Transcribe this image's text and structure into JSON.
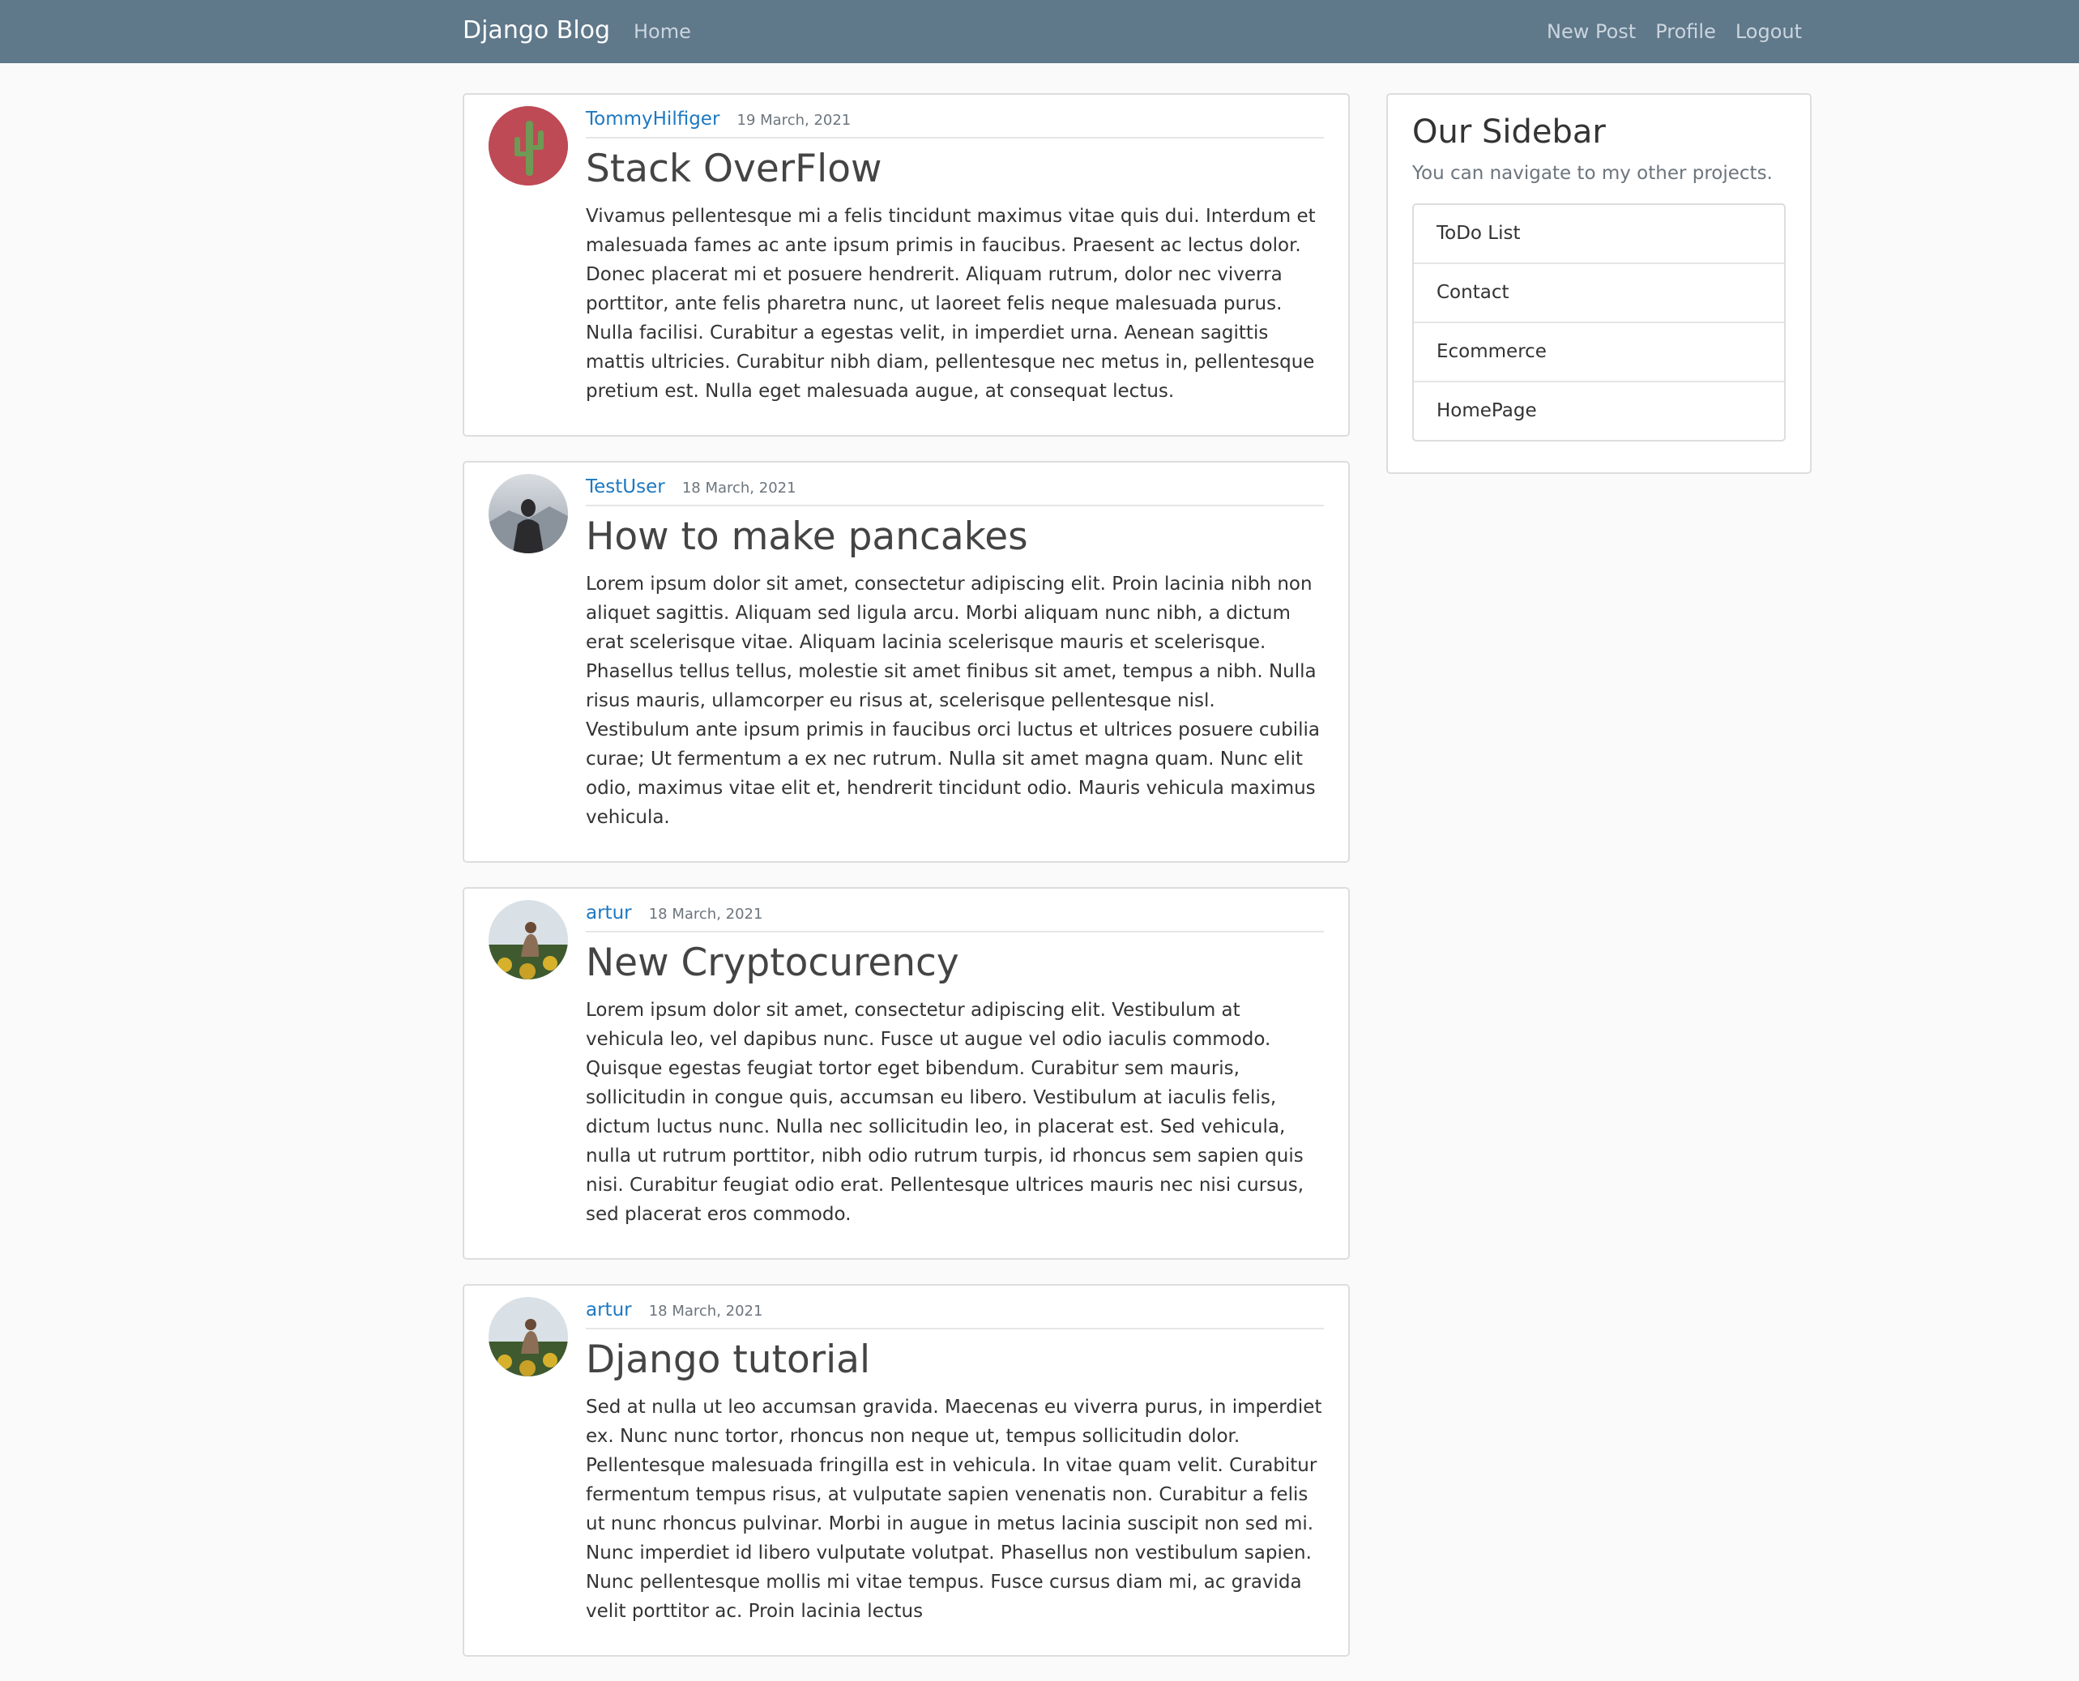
{
  "navbar": {
    "brand": "Django Blog",
    "home": "Home",
    "new_post": "New Post",
    "profile": "Profile",
    "logout": "Logout"
  },
  "posts": [
    {
      "author": "TommyHilfiger",
      "date": "19 March, 2021",
      "title": "Stack OverFlow",
      "content": "Vivamus pellentesque mi a felis tincidunt maximus vitae quis dui. Interdum et malesuada fames ac ante ipsum primis in faucibus. Praesent ac lectus dolor. Donec placerat mi et posuere hendrerit. Aliquam rutrum, dolor nec viverra porttitor, ante felis pharetra nunc, ut laoreet felis neque malesuada purus. Nulla facilisi. Curabitur a egestas velit, in imperdiet urna. Aenean sagittis mattis ultricies. Curabitur nibh diam, pellentesque nec metus in, pellentesque pretium est. Nulla eget malesuada augue, at consequat lectus."
    },
    {
      "author": "TestUser",
      "date": "18 March, 2021",
      "title": "How to make pancakes",
      "content": "Lorem ipsum dolor sit amet, consectetur adipiscing elit. Proin lacinia nibh non aliquet sagittis. Aliquam sed ligula arcu. Morbi aliquam nunc nibh, a dictum erat scelerisque vitae. Aliquam lacinia scelerisque mauris et scelerisque. Phasellus tellus tellus, molestie sit amet finibus sit amet, tempus a nibh. Nulla risus mauris, ullamcorper eu risus at, scelerisque pellentesque nisl. Vestibulum ante ipsum primis in faucibus orci luctus et ultrices posuere cubilia curae; Ut fermentum a ex nec rutrum. Nulla sit amet magna quam. Nunc elit odio, maximus vitae elit et, hendrerit tincidunt odio. Mauris vehicula maximus vehicula."
    },
    {
      "author": "artur",
      "date": "18 March, 2021",
      "title": "New Cryptocurency",
      "content": "Lorem ipsum dolor sit amet, consectetur adipiscing elit. Vestibulum at vehicula leo, vel dapibus nunc. Fusce ut augue vel odio iaculis commodo. Quisque egestas feugiat tortor eget bibendum. Curabitur sem mauris, sollicitudin in congue quis, accumsan eu libero. Vestibulum at iaculis felis, dictum luctus nunc. Nulla nec sollicitudin leo, in placerat est. Sed vehicula, nulla ut rutrum porttitor, nibh odio rutrum turpis, id rhoncus sem sapien quis nisi. Curabitur feugiat odio erat. Pellentesque ultrices mauris nec nisi cursus, sed placerat eros commodo."
    },
    {
      "author": "artur",
      "date": "18 March, 2021",
      "title": "Django tutorial",
      "content": "Sed at nulla ut leo accumsan gravida. Maecenas eu viverra purus, in imperdiet ex. Nunc nunc tortor, rhoncus non neque ut, tempus sollicitudin dolor. Pellentesque malesuada fringilla est in vehicula. In vitae quam velit. Curabitur fermentum tempus risus, at vulputate sapien venenatis non. Curabitur a felis ut nunc rhoncus pulvinar. Morbi in augue in metus lacinia suscipit non sed mi. Nunc imperdiet id libero vulputate volutpat. Phasellus non vestibulum sapien. Nunc pellentesque mollis mi vitae tempus. Fusce cursus diam mi, ac gravida velit porttitor ac. Proin lacinia lectus"
    }
  ],
  "sidebar": {
    "title": "Our Sidebar",
    "subtitle": "You can navigate to my other projects.",
    "links": [
      "ToDo List",
      "Contact",
      "Ecommerce",
      "HomePage"
    ]
  },
  "colors": {
    "navbar_bg": "#5f788a",
    "link": "#1d78c1",
    "page_bg": "#fafafa"
  }
}
